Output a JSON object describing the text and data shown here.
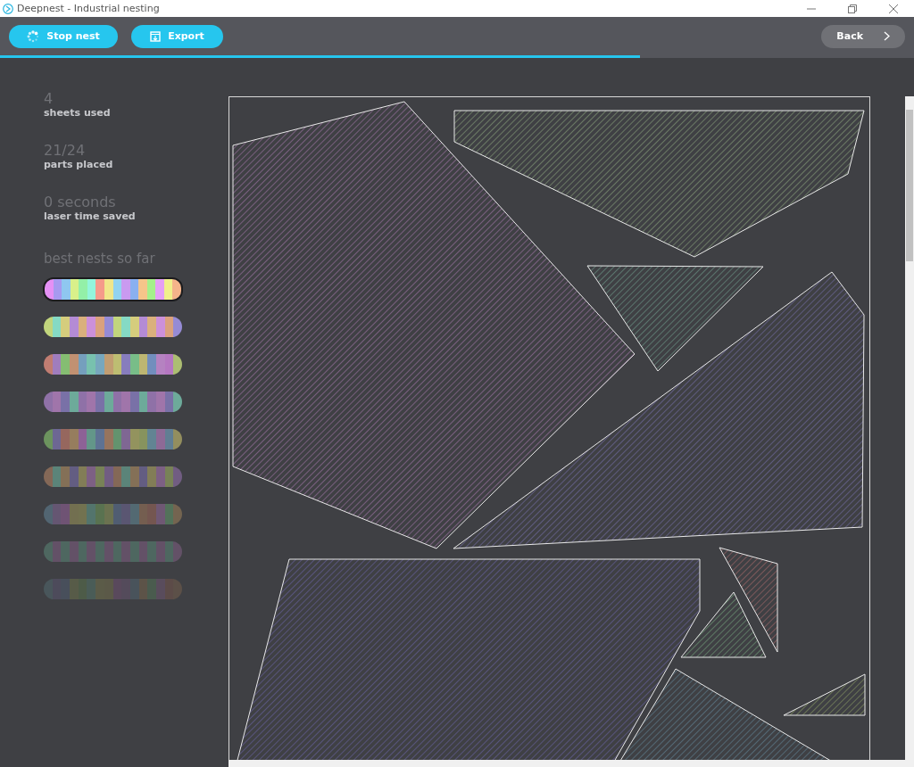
{
  "window": {
    "title": "Deepnest - Industrial nesting"
  },
  "toolbar": {
    "buttons": [
      {
        "kind": "spinner",
        "label": "Stop nest"
      },
      {
        "kind": "export",
        "label": "Export"
      }
    ],
    "back": {
      "label": "Back"
    }
  },
  "progress": {
    "level": 0.7
  },
  "stats": [
    {
      "value": "4",
      "label": "sheets used"
    },
    {
      "value": "21/24",
      "label": "parts placed"
    },
    {
      "value": "0 seconds",
      "label": "laser time saved"
    }
  ],
  "nests_heading": "best nests so far",
  "nests": [
    {
      "selected": true
    },
    {
      "selected": false
    },
    {
      "selected": false
    },
    {
      "selected": false
    },
    {
      "selected": false
    },
    {
      "selected": false
    },
    {
      "selected": false
    },
    {
      "selected": false
    },
    {
      "selected": false
    }
  ]
}
